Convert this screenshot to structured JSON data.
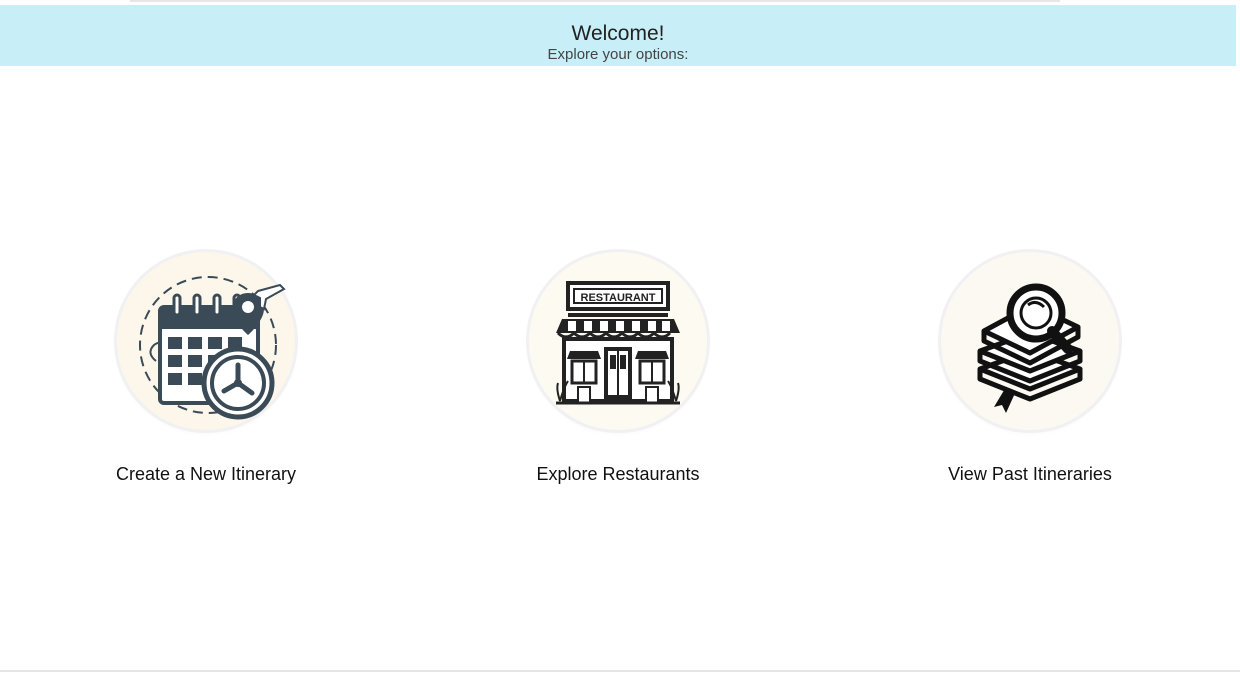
{
  "header": {
    "title": "Welcome!",
    "subtitle": "Explore your options:"
  },
  "colors": {
    "banner": "#c8eff7",
    "icon_ink": "#3a4a56",
    "icon_bg": "#fcf7ea"
  },
  "options": [
    {
      "label": "Create a New Itinerary",
      "icon": "calendar-clock-icon"
    },
    {
      "label": "Explore Restaurants",
      "icon": "restaurant-storefront-icon",
      "icon_text": "RESTAURANT"
    },
    {
      "label": "View Past Itineraries",
      "icon": "books-magnifier-icon"
    }
  ]
}
